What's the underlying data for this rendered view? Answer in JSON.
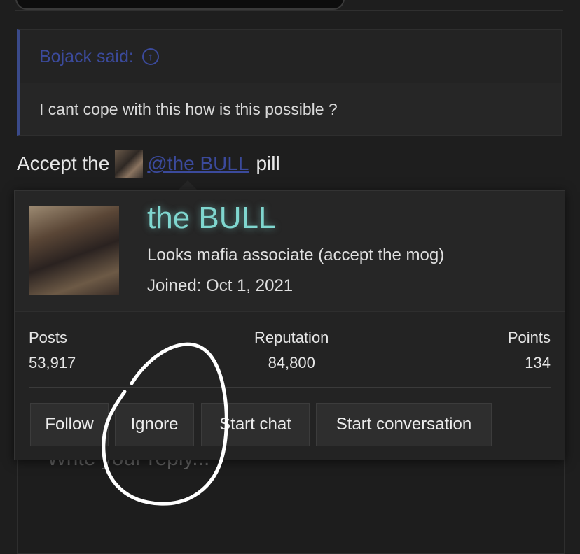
{
  "quote": {
    "author_label": "Bojack said:",
    "icon": "arrow-up-circle-icon",
    "text": "I cant cope with this how is this possible ?"
  },
  "post": {
    "prefix": "Accept the",
    "mention": "@the BULL",
    "suffix": "pill"
  },
  "reply": {
    "placeholder": "Write your reply..."
  },
  "profile_card": {
    "name": "the BULL",
    "user_title": "Looks mafia associate (accept the mog)",
    "joined": "Joined: Oct 1, 2021",
    "stats": {
      "posts_label": "Posts",
      "posts_value": "53,917",
      "reputation_label": "Reputation",
      "reputation_value": "84,800",
      "points_label": "Points",
      "points_value": "134"
    },
    "actions": {
      "follow": "Follow",
      "ignore": "Ignore",
      "start_chat": "Start chat",
      "start_conversation": "Start conversation"
    }
  },
  "colors": {
    "username_glow": "#7fd6cf",
    "link": "#3b4a9c",
    "annotation": "#ffffff"
  }
}
